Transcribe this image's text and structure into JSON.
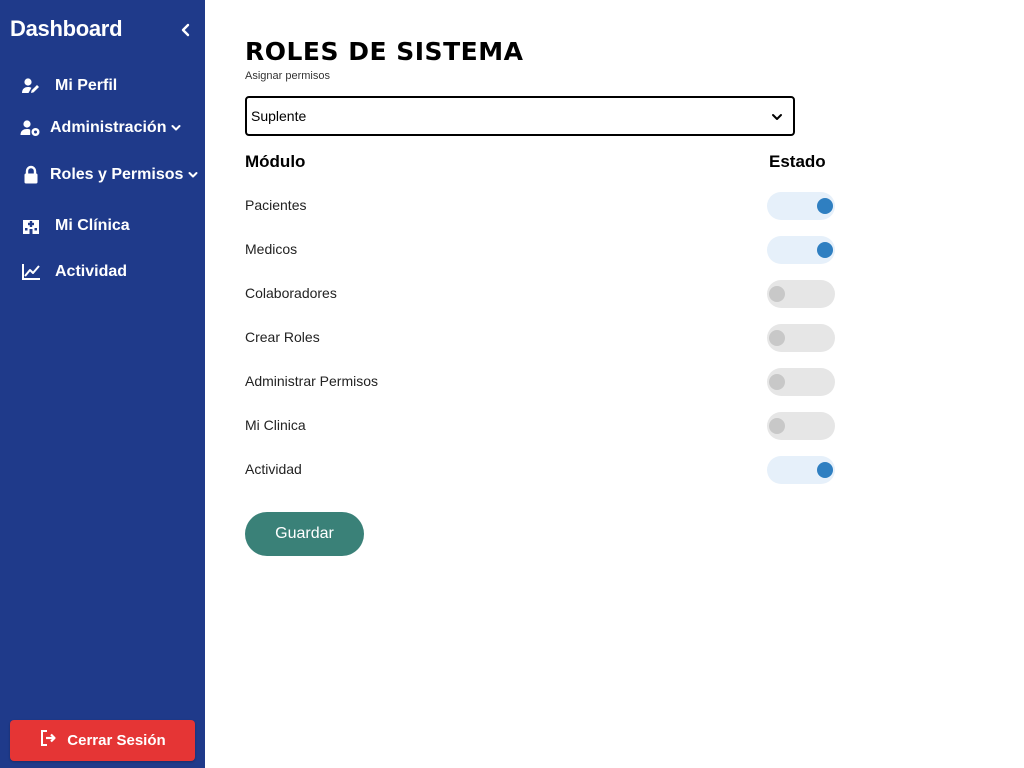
{
  "sidebar": {
    "title": "Dashboard",
    "collapse_icon": "chevron-left-icon",
    "items": [
      {
        "label": "Mi Perfil",
        "icon": "user-edit-icon"
      },
      {
        "label": "Administración",
        "icon": "user-gear-icon",
        "has_dropdown": true
      },
      {
        "label": "Roles y Permisos",
        "icon": "lock-icon",
        "has_dropdown": true
      },
      {
        "label": "Mi Clínica",
        "icon": "hospital-icon"
      },
      {
        "label": "Actividad",
        "icon": "chart-line-icon"
      }
    ],
    "logout_label": "Cerrar Sesión",
    "logout_icon": "sign-out-icon"
  },
  "main": {
    "title": "ROLES DE SISTEMA",
    "subtitle": "Asignar permisos",
    "role_select": {
      "selected": "Suplente"
    },
    "columns": {
      "module": "Módulo",
      "status": "Estado"
    },
    "modules": [
      {
        "name": "Pacientes",
        "enabled": true
      },
      {
        "name": "Medicos",
        "enabled": true
      },
      {
        "name": "Colaboradores",
        "enabled": false
      },
      {
        "name": "Crear Roles",
        "enabled": false
      },
      {
        "name": "Administrar Permisos",
        "enabled": false
      },
      {
        "name": "Mi Clinica",
        "enabled": false
      },
      {
        "name": "Actividad",
        "enabled": true
      }
    ],
    "save_label": "Guardar"
  },
  "colors": {
    "sidebar_bg": "#1f3a8a",
    "logout_bg": "#e53535",
    "save_bg": "#3a8178",
    "toggle_on_knob": "#2f7fc1",
    "toggle_on_track": "#e6f0fa",
    "toggle_off_track": "#e6e6e6"
  }
}
